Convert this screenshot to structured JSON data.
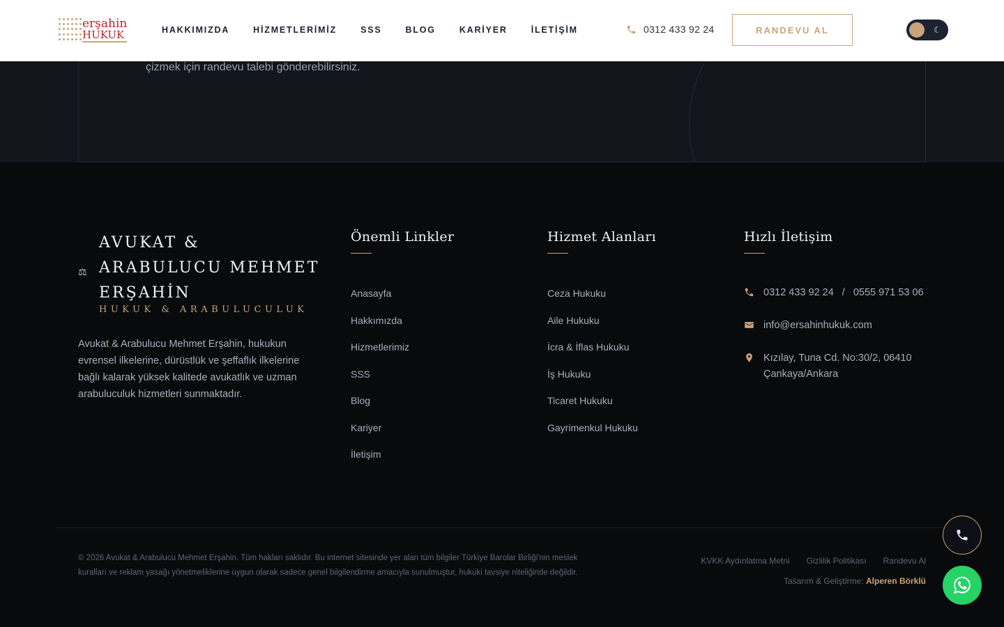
{
  "header": {
    "logo": {
      "line1": "erşahin",
      "line2": "HUKUK"
    },
    "nav": [
      "HAKKIMIZDA",
      "HİZMETLERİMİZ",
      "SSS",
      "BLOG",
      "KARİYER",
      "İLETİŞİM"
    ],
    "phone": "0312 433 92 24",
    "cta_button": "RANDEVU AL",
    "theme_toggle": {
      "mode": "dark",
      "icon": "moon-icon"
    }
  },
  "cta": {
    "text": "çizmek için randevu talebi gönderebilirsiniz."
  },
  "footer": {
    "brand": {
      "title": "AVUKAT & ARABULUCU MEHMET ERŞAHİN",
      "subtitle": "HUKUK & ARABULUCULUK",
      "icon": "scales-icon"
    },
    "about": "Avukat & Arabulucu Mehmet Erşahin, hukukun evrensel ilkelerine, dürüstlük ve şeffaflık ilkelerine bağlı kalarak yüksek kalitede avukatlık ve uzman arabuluculuk hizmetleri sunmaktadır.",
    "links": {
      "heading": "Önemli Linkler",
      "items": [
        "Anasayfa",
        "Hakkımızda",
        "Hizmetlerimiz",
        "SSS",
        "Blog",
        "Kariyer",
        "İletişim"
      ]
    },
    "services": {
      "heading": "Hizmet Alanları",
      "items": [
        "Ceza Hukuku",
        "Aile Hukuku",
        "İcra & İflas Hukuku",
        "İş Hukuku",
        "Ticaret Hukuku",
        "Gayrimenkul Hukuku"
      ]
    },
    "contact": {
      "heading": "Hızlı İletişim",
      "phone1": "0312 433 92 24",
      "separator": "/",
      "phone2": "0555 971 53 06",
      "email": "info@ersahinhukuk.com",
      "address_line1": "Kızılay, Tuna Cd. No:30/2, 06410",
      "address_line2": "Çankaya/Ankara"
    },
    "copyright": "© 2026 Avukat & Arabulucu Mehmet Erşahin. Tüm hakları saklıdır. Bu internet sitesinde yer alan tüm bilgiler Türkiye Barolar Birliği'nin meslek kuralları ve reklam yasağı yönetmeliklerine uygun olarak sadece genel bilgilendirme amacıyla sunulmuştur, hukuki tavsiye niteliğinde değildir.",
    "legal_links": [
      "KVKK Aydınlatma Metni",
      "Gizlilik Politikası",
      "Randevu Al"
    ],
    "credit_prefix": "Tasarım & Geliştirme:",
    "credit_name": "Alperen Börklü"
  },
  "colors": {
    "accent": "#c9a47a",
    "logo_red": "#b8252d",
    "footer_bg": "#090a0c",
    "whatsapp": "#25d366"
  }
}
